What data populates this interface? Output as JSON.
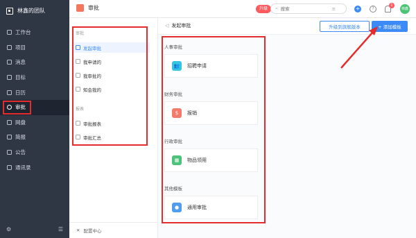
{
  "sidebar": {
    "team_name": "林鑫的团队",
    "items": [
      {
        "label": "工作台",
        "icon": "home-icon"
      },
      {
        "label": "项目",
        "icon": "project-icon"
      },
      {
        "label": "消息",
        "icon": "message-icon"
      },
      {
        "label": "目标",
        "icon": "target-icon"
      },
      {
        "label": "日历",
        "icon": "calendar-icon"
      },
      {
        "label": "审批",
        "icon": "approval-icon",
        "active": true
      },
      {
        "label": "网盘",
        "icon": "drive-icon"
      },
      {
        "label": "简报",
        "icon": "report-icon"
      },
      {
        "label": "公告",
        "icon": "announcement-icon"
      },
      {
        "label": "通讯录",
        "icon": "contacts-icon"
      }
    ]
  },
  "topbar": {
    "title": "审批",
    "upgrade_badge": "升级",
    "search_placeholder": "搜索",
    "notification_count": "1",
    "avatar_text": "林鑫"
  },
  "subnav": {
    "group1": "审批",
    "group1_items": [
      "发起审批",
      "我申请的",
      "我审批的",
      "知会我的"
    ],
    "group2": "报表",
    "group2_items": [
      "审批报表",
      "审批汇总"
    ],
    "footer": "配置中心"
  },
  "main": {
    "header_title": "发起审批",
    "upgrade_button": "升级到旗舰版本",
    "add_button": "+ 添加模板",
    "categories": [
      {
        "title": "人事审批",
        "card": "招聘申请",
        "color": "#36c5e0"
      },
      {
        "title": "财务审批",
        "card": "报销",
        "color": "#f47a6b"
      },
      {
        "title": "行政审批",
        "card": "物品领用",
        "color": "#4cc27a"
      },
      {
        "title": "其他模板",
        "card": "通用审批",
        "color": "#4f9cf0"
      }
    ]
  },
  "colors": {
    "accent": "#3c8af5",
    "highlight_box": "#e52b2b",
    "sidebar_bg": "#2f3644"
  }
}
